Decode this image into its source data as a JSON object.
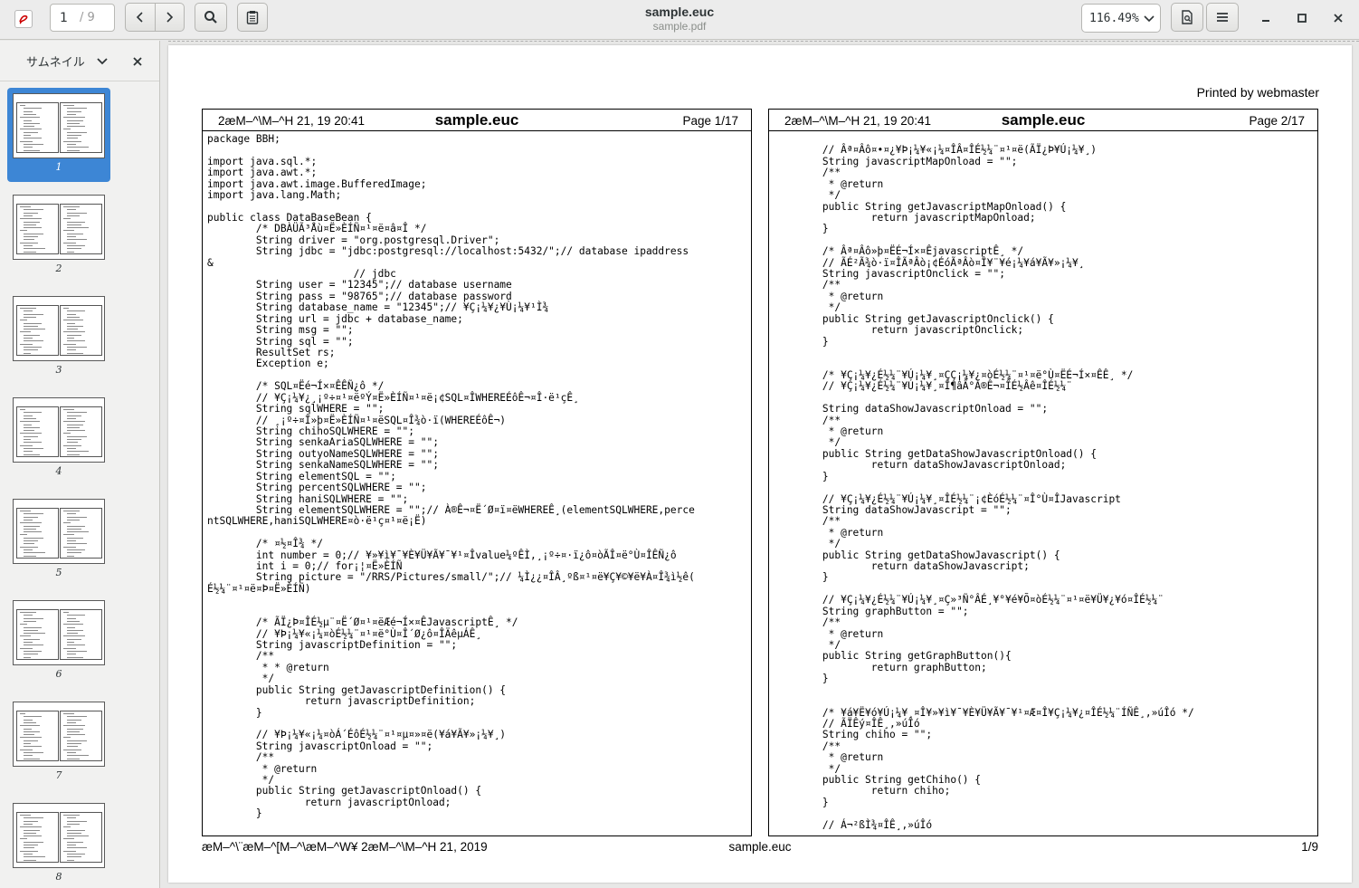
{
  "header": {
    "title": "sample.euc",
    "subtitle": "sample.pdf",
    "page_input": "1",
    "page_total": "/ 9",
    "zoom": "116.49%"
  },
  "sidebar": {
    "view_label": "サムネイル",
    "thumbnails": [
      {
        "label": "1",
        "selected": true
      },
      {
        "label": "2",
        "selected": false
      },
      {
        "label": "3",
        "selected": false
      },
      {
        "label": "4",
        "selected": false
      },
      {
        "label": "5",
        "selected": false
      },
      {
        "label": "6",
        "selected": false
      },
      {
        "label": "7",
        "selected": false
      },
      {
        "label": "8",
        "selected": false
      }
    ]
  },
  "document": {
    "printed_by": "Printed by webmaster",
    "left": {
      "date": "2æM–^\\M–^H 21, 19 20:41",
      "filename": "sample.euc",
      "page": "Page 1/17",
      "code": "package BBH;\n\nimport java.sql.*;\nimport java.awt.*;\nimport java.awt.image.BufferedImage;\nimport java.lang.Math;\n\npublic class DataBaseBean {\n        /* DBÀÜÃ³Åù¤Ë»ÈÍÑ¤¹¤ë¤â¤Î */\n        String driver = \"org.postgresql.Driver\";\n        String jdbc = \"jdbc:postgresql://localhost:5432/\";// database ipaddress\n&\n                        // jdbc\n        String user = \"12345\";// database username\n        String pass = \"98765\";// database password\n        String database_name = \"12345\";// ¥Ç¡¼¥¿¥Ù¡¼¥¹Ì¾\n        String url = jdbc + database_name;\n        String msg = \"\";\n        String sql = \"\";\n        ResultSet rs;\n        Exception e;\n\n        /* SQL¤Ëé¬Í×¤ÊÊÑ¿ô */\n        // ¥Ç¡¼¥¿¸¡º÷¤¹¤ëºÝ¤Ë»ÈÍÑ¤¹¤ë¡¢SQL¤ÎWHEREÉôÊ¬¤Î·ë¹çÊ¸\n        String sqlWHERE = \"\";\n        // ¸¡º÷¤Î»þ¤Ë»ÈÍÑ¤¹¤ëSQL¤Î¾ò·ï(WHEREÉôÊ¬)\n        String chihoSQLWHERE = \"\";\n        String senkaAriaSQLWHERE = \"\";\n        String outyoNameSQLWHERE = \"\";\n        String senkaNameSQLWHERE = \"\";\n        String elementSQL = \"\";\n        String percentSQLWHERE = \"\";\n        String haniSQLWHERE = \"\";\n        String elementSQLWHERE = \"\";// À®Ê¬¤Ë´Ø¤ï¤ëWHEREÊ¸(elementSQLWHERE,perce\nntSQLWHERE,haniSQLWHERE¤ò·ë¹ç¤¹¤ë¡Ë)\n\n        /* ¤½¤Î¾ */\n        int number = 0;// ¥»¥ì¥¯¥È¥Ü¥Ã¥¯¥¹¤Îvalue¼ºÊÌ,¸¡º÷¤·ï¿ô¤òÃÎ¤ë°Ù¤ÎÊÑ¿ô\n        int i = 0;// for¡¦¤Ë»ÈÍÑ\n        String picture = \"/RRS/Pictures/small/\";// ¼Ì¿¿¤ÎÂ¸ºß¤¹¤ë¥Ç¥©¥ë¥À¤Î¾ì½ê(\nÉ½¼¨¤¹¤ë¤Þ¤Ë»ÈÍÑ)\n\n\n        /* ÃÏ¿Þ¤ÎÉ½µ¨¤Ë´Ø¤¹¤ëÆé¬Í×¤ÊJavascriptÊ¸ */\n        // ¥Þ¡¼¥«¡¼¤òÉ½¼¨¤¹¤ë°Ù¤Î´Ø¿ô¤ÎÄêµÁÊ¸\n        String javascriptDefinition = \"\";\n        /**\n         * * @return\n         */\n        public String getJavascriptDefinition() {\n                return javascriptDefinition;\n        }\n\n        // ¥Þ¡¼¥«¡¼¤òÁ´ÉôÉ½¼¨¤¹¤µ¤»¤ë(¥á¥Ã¥»¡¼¥¸)\n        String javascriptOnload = \"\";\n        /**\n         * @return\n         */\n        public String getJavascriptOnload() {\n                return javascriptOnload;\n        }"
    },
    "right": {
      "date": "2æM–^\\M–^H 21, 19 20:41",
      "filename": "sample.euc",
      "page": "Page 2/17",
      "code": "\n        // Âª¤Âô¤•¤¿¥Þ¡¼¥«¡¼¤ÎÂ¤ÎÉ½¼¨¤¹¤ë(ÃÏ¿Þ¥Ú¡¼¥¸)\n        String javascriptMapOnload = \"\";\n        /**\n         * @return\n         */\n        public String getJavascriptMapOnload() {\n                return javascriptMapOnload;\n        }\n\n        /* Âª¤Âô»þ¤ËÉ¬Í×¤ÊjavascriptÊ¸ */\n        // ÃÉ²Ã¾ò·ï¤ÎÃªÂò¡¢ÉóÃªÂò¤Î¥¨¥é¡¼¥á¥Ã¥»¡¼¥¸\n        String javascriptOnclick = \"\";\n        /**\n         * @return\n         */\n        public String getJavascriptOnclick() {\n                return javascriptOnclick;\n        }\n\n\n        /* ¥Ç¡¼¥¿É½¼¨¥Ú¡¼¥¸¤ÇÇ¡¼¥¿¤òÉ½¼¨¤¹¤ë°Ù¤ËÉ¬Í×¤ÊÊ¸ */\n        // ¥Ç¡¼¥¿É½¼¨¥Ú¡¼¥¸¤Î¶âÂ°À®Ê¬¤ÎÉ½Âê¤ÎÉ½¼¨\n\n        String dataShowJavascriptOnload = \"\";\n        /**\n         * @return\n         */\n        public String getDataShowJavascriptOnload() {\n                return dataShowJavascriptOnload;\n        }\n\n        // ¥Ç¡¼¥¿É½¼¨¥Ú¡¼¥¸¤ÎÉ½¼¨¡¢ÈóÉ½¼¨¤Î°Ù¤ÎJavascript\n        String dataShowJavascript = \"\";\n        /**\n         * @return\n         */\n        public String getDataShowJavascript() {\n                return dataShowJavascript;\n        }\n\n        // ¥Ç¡¼¥¿É½¼¨¥Ú¡¼¥¸¤Ç»³Ñ°ÂÉ¸¥°¥é¥Õ¤òÉ½¼¨¤¹¤ë¥Ü¥¿¥ó¤ÎÉ½¼¨\n        String graphButton = \"\";\n        /**\n         * @return\n         */\n        public String getGraphButton(){\n                return graphButton;\n        }\n\n\n        /* ¥á¥Ë¥ó¥Ú¡¼¥¸¤Î¥»¥ì¥¯¥È¥Ü¥Ã¥¯¥¹¤Æ¤Î¥Ç¡¼¥¿¤ÎÉ½¼¨ÍÑÊ¸,»úÎó */\n        // ÃÏÊý¤ÎÊ¸,»úÎó\n        String chiho = \"\";\n        /**\n         * @return\n         */\n        public String getChiho() {\n                return chiho;\n        }\n\n        // Á¬²ßÌ¾¤ÎÊ¸,»úÎó"
    },
    "footer_left": "æM–^\\¨æM–^[M–^\\æM–^W¥ 2æM–^\\M–^H 21, 2019",
    "footer_mid": "sample.euc",
    "footer_right": "1/9"
  }
}
